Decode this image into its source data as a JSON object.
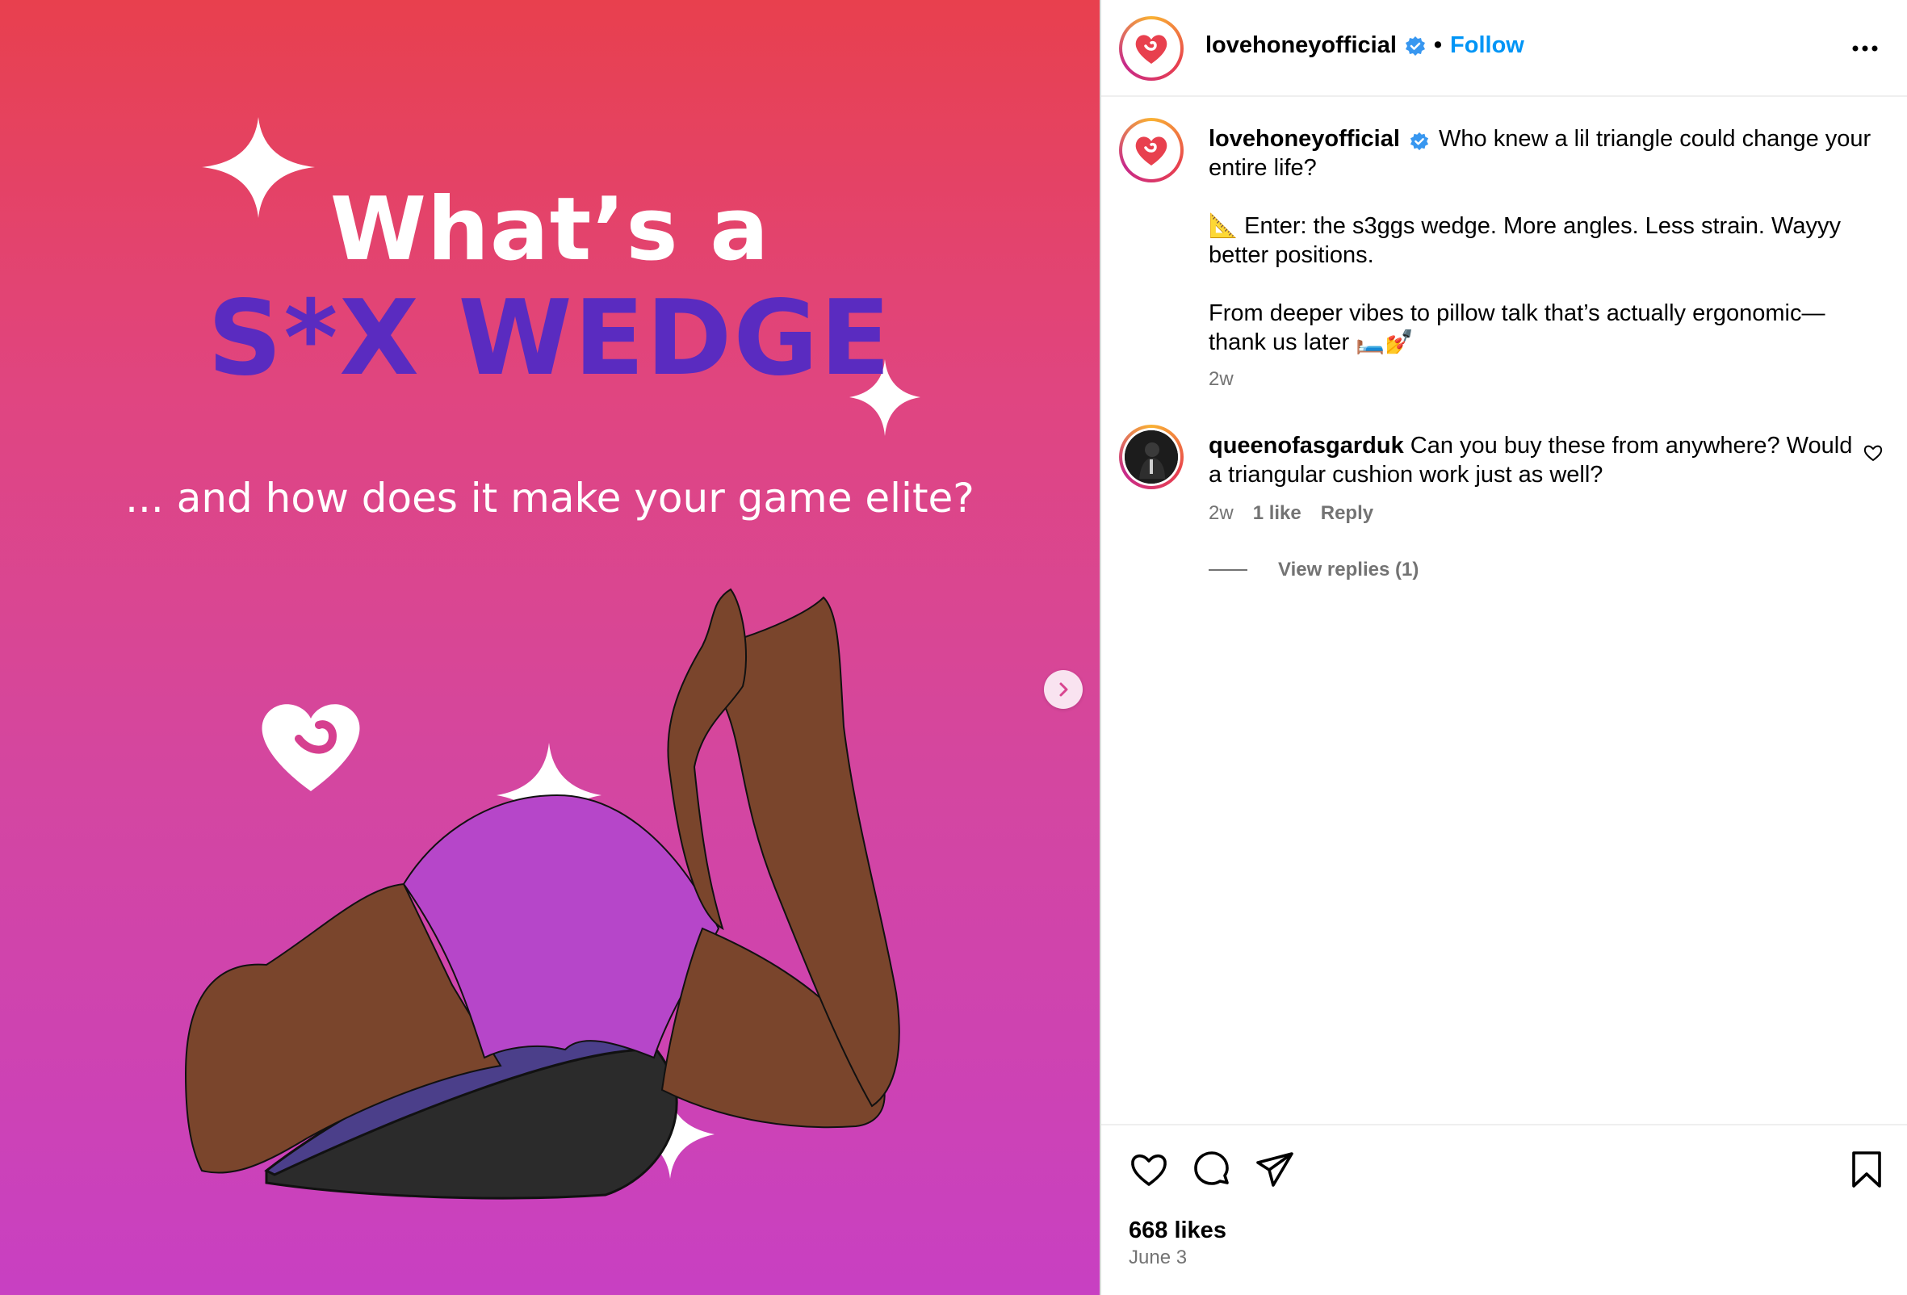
{
  "post_image": {
    "headline_line1": "What’s a",
    "headline_line2": "S*X WEDGE",
    "subline": "... and how does it make your game elite?",
    "next_icon": "chevron-right-icon",
    "brand_icon": "lovehoney-heart-logo"
  },
  "header": {
    "username": "lovehoneyofficial",
    "separator": "•",
    "follow_label": "Follow",
    "more_icon": "more-horizontal-icon"
  },
  "caption": {
    "username": "lovehoneyofficial",
    "line1": "Who knew a lil triangle could change your",
    "line2": "entire life?",
    "para2_line1": "📐 Enter: the s3ggs wedge. More angles. Less strain. Wayyy",
    "para2_line2": "better positions.",
    "para3_line1": "From deeper vibes to pillow talk that’s actually ergonomic—",
    "para3_line2": "thank us later 🛏️💅",
    "time": "2w"
  },
  "comment": {
    "username": "queenofasgarduk",
    "line1": "Can you buy these from anywhere? Would",
    "line2": "a triangular cushion work just as well?",
    "time": "2w",
    "likes": "1 like",
    "reply_label": "Reply",
    "view_replies": "View replies (1)"
  },
  "actions": {
    "likes": "668 likes",
    "date": "June 3"
  },
  "colors": {
    "accent_blue": "#0095f6",
    "verified_blue": "#3897f0",
    "headline_purple": "#5a2bc0",
    "brand_red": "#e8404e"
  }
}
